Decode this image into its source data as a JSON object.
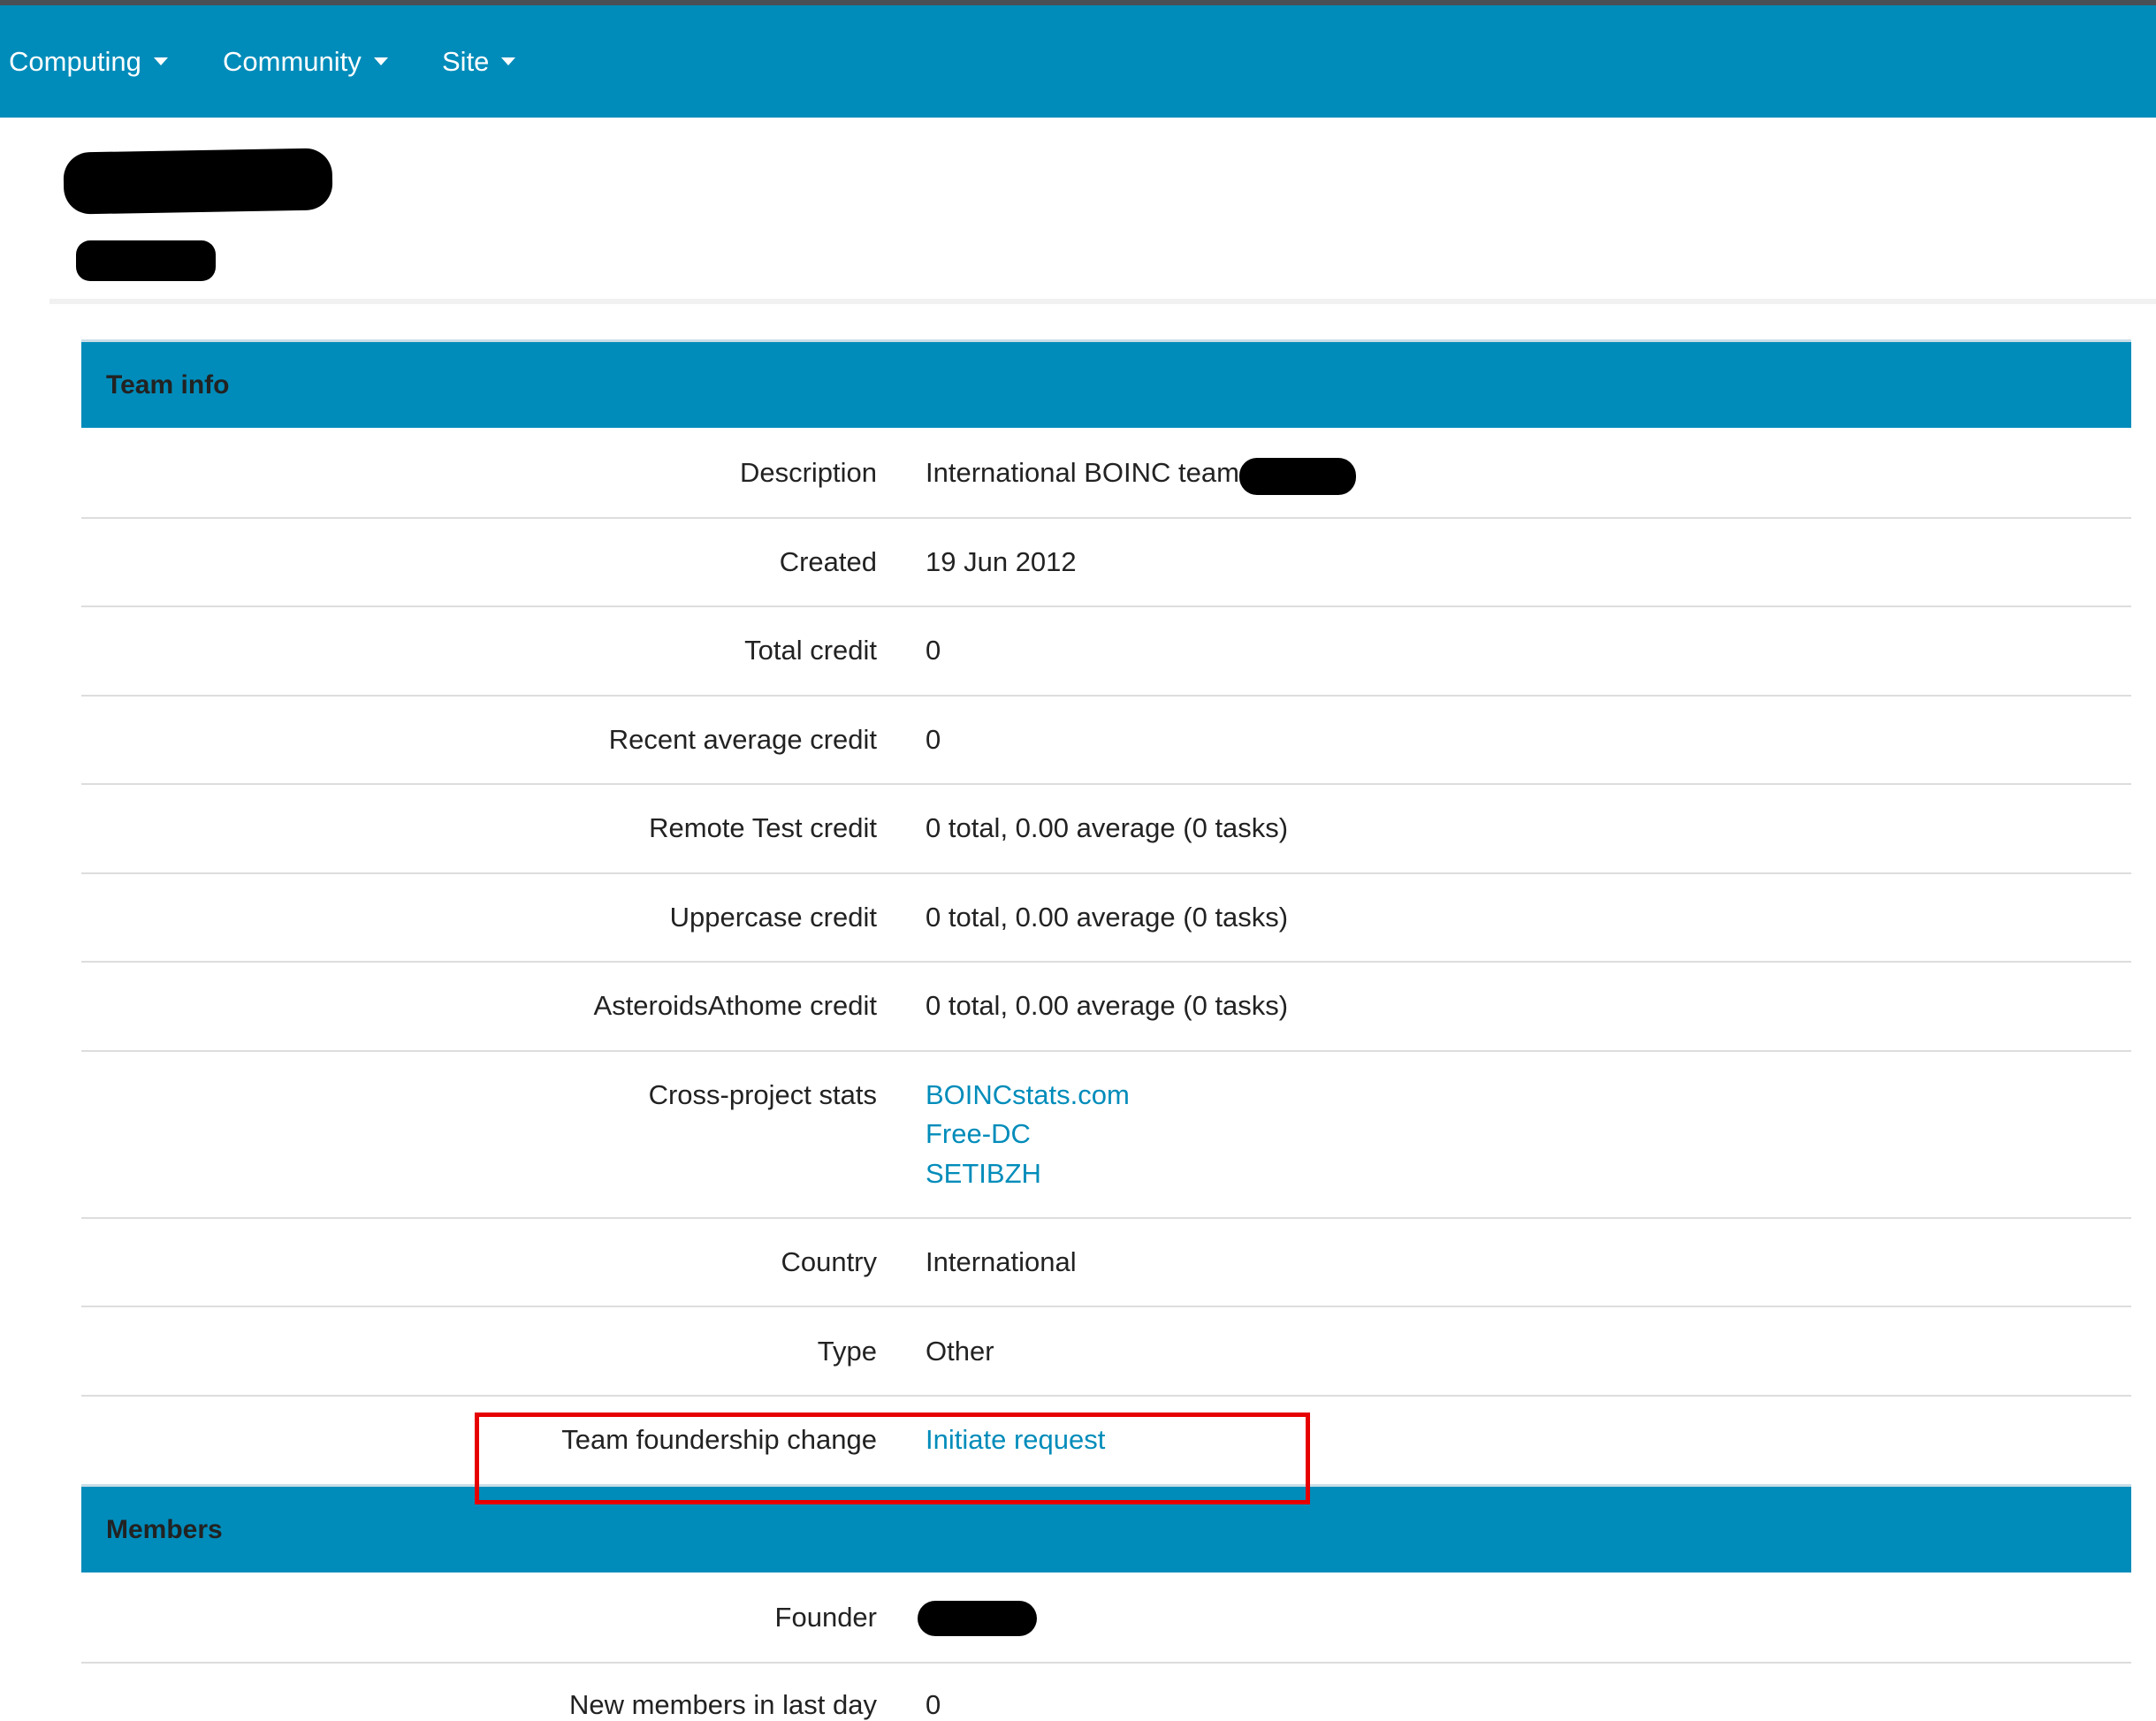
{
  "nav": {
    "items": [
      {
        "label": "Computing"
      },
      {
        "label": "Community"
      },
      {
        "label": "Site"
      }
    ]
  },
  "sections": {
    "team_info": "Team info",
    "members": "Members"
  },
  "team_info": {
    "description": {
      "label": "Description",
      "value": "International BOINC team"
    },
    "created": {
      "label": "Created",
      "value": "19 Jun 2012"
    },
    "total_credit": {
      "label": "Total credit",
      "value": "0"
    },
    "recent_average_credit": {
      "label": "Recent average credit",
      "value": "0"
    },
    "remote_test_credit": {
      "label": "Remote Test credit",
      "value": "0 total, 0.00 average (0 tasks)"
    },
    "uppercase_credit": {
      "label": "Uppercase credit",
      "value": "0 total, 0.00 average (0 tasks)"
    },
    "asteroids_credit": {
      "label": "AsteroidsAthome credit",
      "value": "0 total, 0.00 average (0 tasks)"
    },
    "cross_project_stats": {
      "label": "Cross-project stats",
      "links": [
        "BOINCstats.com",
        "Free-DC",
        "SETIBZH"
      ]
    },
    "country": {
      "label": "Country",
      "value": "International"
    },
    "type": {
      "label": "Type",
      "value": "Other"
    },
    "foundership": {
      "label": "Team foundership change",
      "link": "Initiate request"
    }
  },
  "members": {
    "founder": {
      "label": "Founder"
    },
    "new_members": {
      "label": "New members in last day",
      "value": "0"
    }
  },
  "colors": {
    "navbar": "#008cba",
    "section_header": "#008cba",
    "link": "#008cba",
    "highlight": "#e60000"
  }
}
